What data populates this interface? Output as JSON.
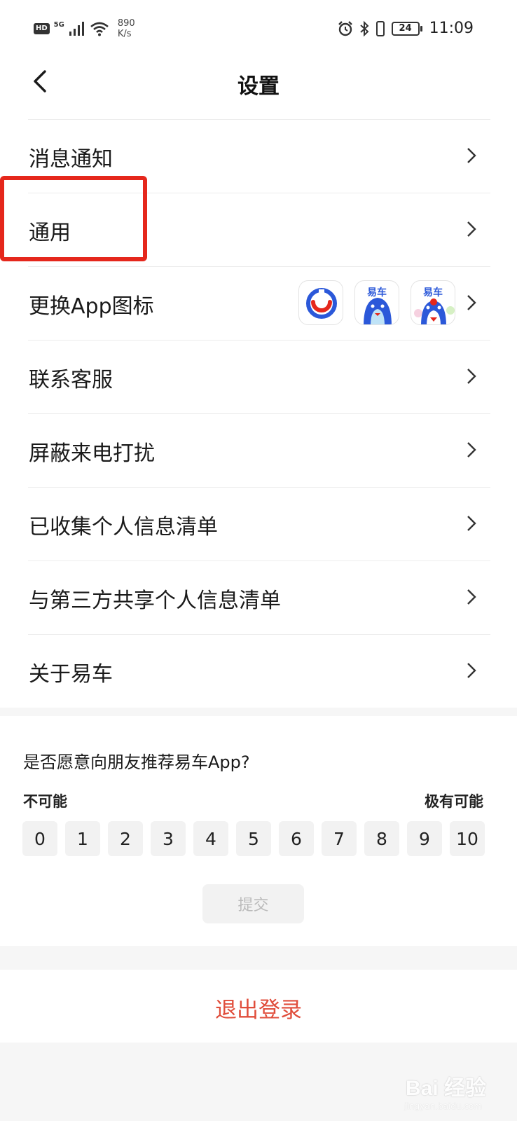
{
  "status_bar": {
    "hd": "HD",
    "network": "5G",
    "speed_value": "890",
    "speed_unit": "K/s",
    "battery": "24",
    "time": "11:09"
  },
  "header": {
    "title": "设置"
  },
  "settings": {
    "items": [
      {
        "label": "消息通知"
      },
      {
        "label": "通用"
      },
      {
        "label": "更换App图标"
      },
      {
        "label": "联系客服"
      },
      {
        "label": "屏蔽来电打扰"
      },
      {
        "label": "已收集个人信息清单"
      },
      {
        "label": "与第三方共享个人信息清单"
      },
      {
        "label": "关于易车"
      }
    ],
    "app_icon_brand": "易车"
  },
  "survey": {
    "question": "是否愿意向朋友推荐易车App?",
    "low_label": "不可能",
    "high_label": "极有可能",
    "scores": [
      "0",
      "1",
      "2",
      "3",
      "4",
      "5",
      "6",
      "7",
      "8",
      "9",
      "10"
    ],
    "submit_label": "提交"
  },
  "logout": {
    "label": "退出登录"
  },
  "watermark": {
    "text": "Bai 经验",
    "sub": "jingyan.baidu.com"
  },
  "colors": {
    "accent_red": "#e04d3b",
    "highlight_red": "#e5271c",
    "brand_blue": "#2b58d9"
  }
}
